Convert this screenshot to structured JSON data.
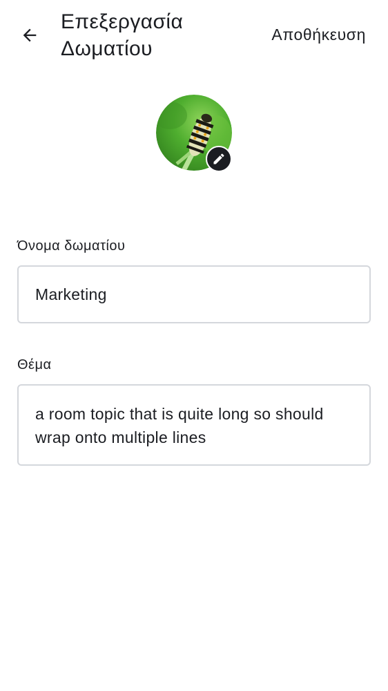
{
  "header": {
    "title": "Επεξεργασία Δωματίου",
    "save_label": "Αποθήκευση",
    "back_icon": "arrow-left-icon"
  },
  "avatar": {
    "image": "caterpillar-photo",
    "edit_icon": "pencil-icon"
  },
  "fields": {
    "name_label": "Όνομα δωματίου",
    "name_value": "Marketing",
    "topic_label": "Θέμα",
    "topic_value": "a room topic that is quite long so should wrap onto multiple lines"
  },
  "colors": {
    "text": "#1b1d22",
    "border": "#d4d7dc",
    "background": "#ffffff",
    "badge": "#1b1d22"
  }
}
